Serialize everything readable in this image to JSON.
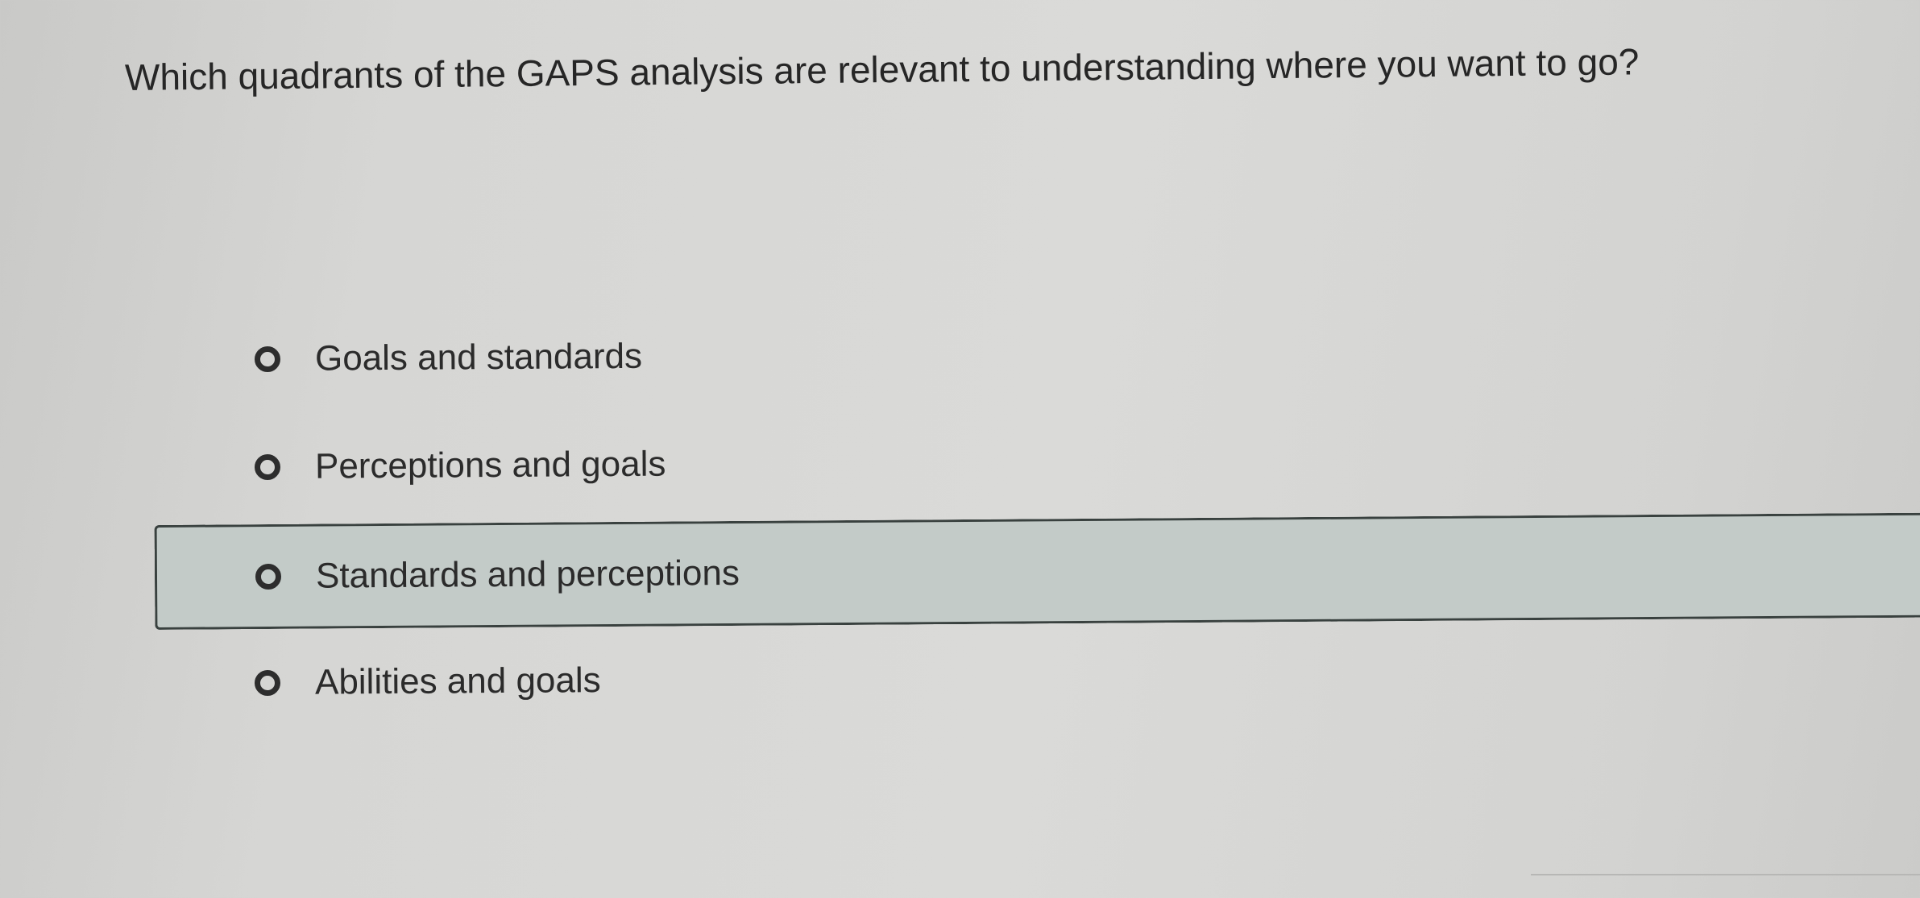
{
  "question": {
    "text": "Which quadrants of the GAPS analysis are relevant to understanding where you want to go?"
  },
  "options": [
    {
      "label": "Goals and standards",
      "selected": false,
      "highlighted": false
    },
    {
      "label": "Perceptions and goals",
      "selected": false,
      "highlighted": false
    },
    {
      "label": "Standards and perceptions",
      "selected": false,
      "highlighted": true
    },
    {
      "label": "Abilities and goals",
      "selected": false,
      "highlighted": false
    }
  ],
  "colors": {
    "background": "#d6d6d4",
    "highlight_fill": "#c3cbc8",
    "highlight_border": "#39413f",
    "text": "#2b2b2b"
  }
}
